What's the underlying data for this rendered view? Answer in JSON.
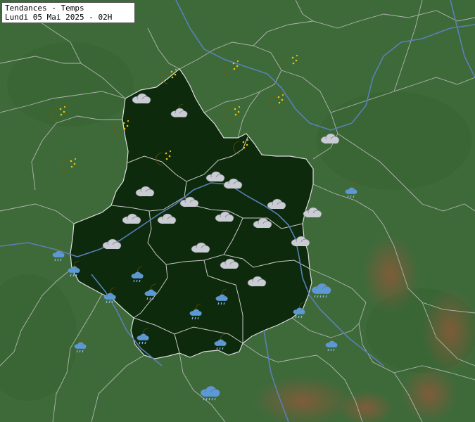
{
  "header": {
    "title": "Tendances - Temps",
    "date_line": "Lundi 05 Mai 2025 - 02H"
  },
  "colors": {
    "land": "#3e6a3a",
    "region": "#0d2a0c",
    "border": "#c8c8c8",
    "river": "#5a7fb8",
    "moon": "#f2c400",
    "cloud": "#c9ccd2",
    "rain_cloud": "#5b9ad6",
    "relief": "#8a5a3a"
  },
  "weather_icons": [
    {
      "type": "moon-stars-icon"
    },
    {
      "type": "moon-stars-icon"
    },
    {
      "type": "moon-stars-icon"
    },
    {
      "type": "moon-stars-icon"
    },
    {
      "type": "moon-stars-icon"
    },
    {
      "type": "moon-stars-icon"
    },
    {
      "type": "moon-stars-icon"
    },
    {
      "type": "moon-stars-icon"
    },
    {
      "type": "moon-stars-icon"
    },
    {
      "type": "moon-stars-icon"
    },
    {
      "type": "cloud-icon"
    },
    {
      "type": "moon-cloud-icon"
    },
    {
      "type": "cloud-icon"
    },
    {
      "type": "cloud-icon"
    },
    {
      "type": "cloud-icon"
    },
    {
      "type": "cloud-icon"
    },
    {
      "type": "cloud-icon"
    },
    {
      "type": "cloud-icon"
    },
    {
      "type": "cloud-icon"
    },
    {
      "type": "cloud-icon"
    },
    {
      "type": "cloud-icon"
    },
    {
      "type": "cloud-icon"
    },
    {
      "type": "cloud-icon"
    },
    {
      "type": "cloud-icon"
    },
    {
      "type": "cloud-icon"
    },
    {
      "type": "cloud-icon"
    },
    {
      "type": "cloud-icon"
    },
    {
      "type": "cloud-icon"
    },
    {
      "type": "moon-rain-icon"
    },
    {
      "type": "moon-rain-icon"
    },
    {
      "type": "moon-rain-icon"
    },
    {
      "type": "moon-rain-icon"
    },
    {
      "type": "moon-rain-icon"
    },
    {
      "type": "moon-rain-icon"
    },
    {
      "type": "moon-rain-icon"
    },
    {
      "type": "moon-rain-icon"
    },
    {
      "type": "moon-rain-icon"
    },
    {
      "type": "moon-rain-icon"
    },
    {
      "type": "moon-rain-icon"
    },
    {
      "type": "moon-rain-icon"
    },
    {
      "type": "moon-rain-icon"
    },
    {
      "type": "rain-cloud-icon"
    },
    {
      "type": "rain-cloud-icon"
    }
  ]
}
